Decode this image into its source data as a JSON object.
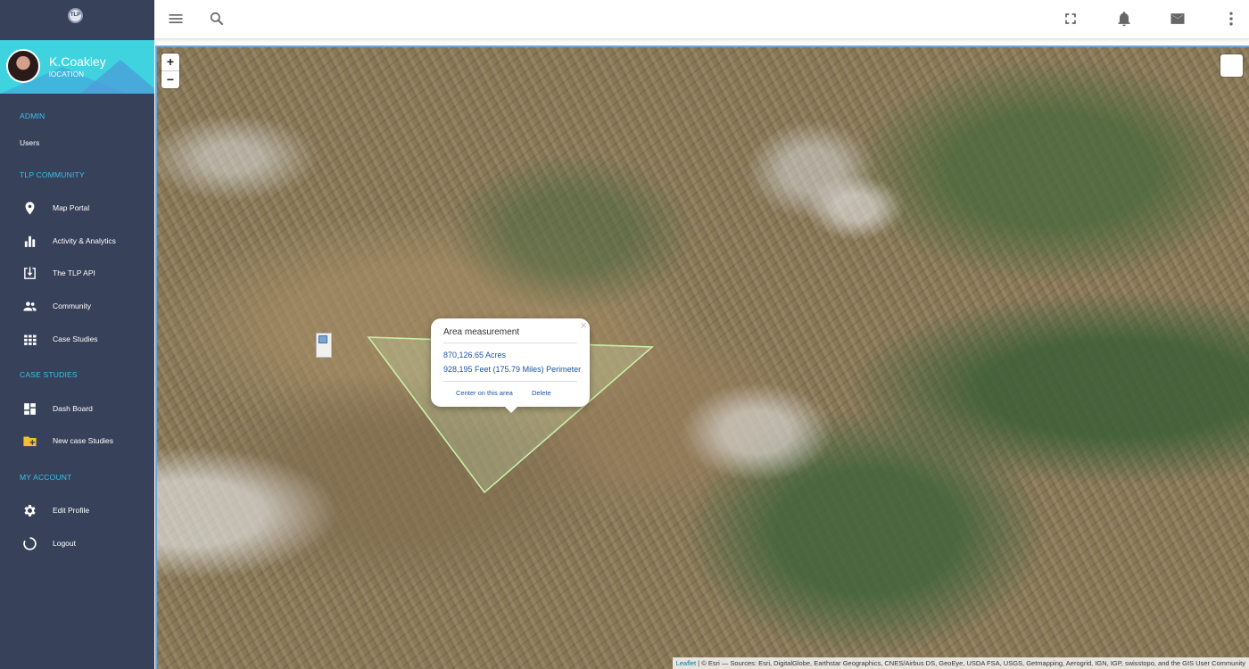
{
  "sidebar": {
    "logo_text": "TLP",
    "profile": {
      "name": "K.Coakley",
      "location": "lOCATION"
    },
    "sections": {
      "admin": "ADMIN",
      "community": "TLP COMMUNITY",
      "case_studies": "CASE STUDIES",
      "account": "MY ACCOUNT"
    },
    "items": {
      "users": "Users",
      "map_portal": "Map Portal",
      "activity": "Activity & Analytics",
      "api": "The TLP API",
      "community": "Community",
      "case_studies": "Case Studies",
      "dashboard": "Dash Board",
      "new_case": "New case Studies",
      "edit_profile": "Edit Profile",
      "logout": "Logout"
    },
    "colors": {
      "background": "#37415a",
      "section": "#38c2e8",
      "profile_bg": "#3fd3df",
      "folder_icon": "#f5c12b"
    }
  },
  "topbar": {
    "icons": [
      "menu-icon",
      "search-icon",
      "fullscreen-icon",
      "bell-icon",
      "mail-icon",
      "more-vert-icon"
    ]
  },
  "map": {
    "zoom_in": "+",
    "zoom_out": "−",
    "popup": {
      "close": "×",
      "title": "Area measurement",
      "acres": "870,126.65 Acres",
      "perimeter": "928,195 Feet (175.79 Miles) Perimeter",
      "center_link": "Center on this area",
      "delete_link": "Delete"
    },
    "attribution": {
      "leaflet": "Leaflet",
      "text": " | © Esri — Sources: Esri, DigitalGlobe, Earthstar Geographics, CNES/Airbus DS, GeoEye, USDA FSA, USGS, Getmapping, Aerogrid, IGN, IGP, swisstopo, and the GIS User Community"
    },
    "polygon_color": "#c8f0a8"
  }
}
